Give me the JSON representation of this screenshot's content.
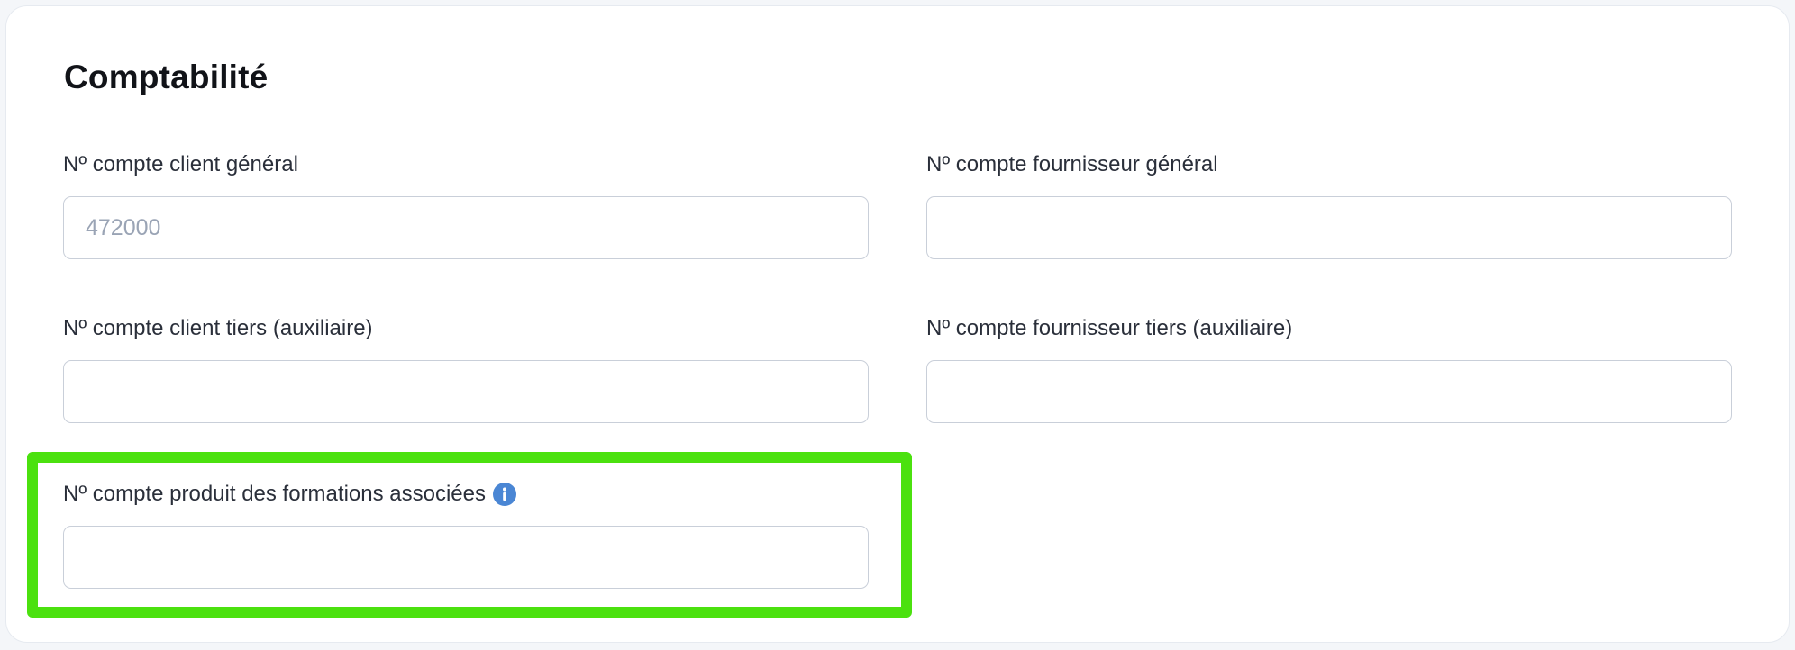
{
  "section": {
    "title": "Comptabilité"
  },
  "fields": [
    {
      "label": "Nº compte client général",
      "value": "",
      "placeholder": "472000"
    },
    {
      "label": "Nº compte fournisseur général",
      "value": "",
      "placeholder": ""
    },
    {
      "label": "Nº compte client tiers (auxiliaire)",
      "value": "",
      "placeholder": ""
    },
    {
      "label": "Nº compte fournisseur tiers (auxiliaire)",
      "value": "",
      "placeholder": ""
    },
    {
      "label": "Nº compte produit des formations associées",
      "value": "",
      "placeholder": "",
      "info_icon": "info-icon"
    }
  ],
  "colors": {
    "highlight": "#4be10f",
    "info_icon": "#4a86d4",
    "input_border": "#c9cfd9",
    "placeholder": "#9aa4b5"
  }
}
